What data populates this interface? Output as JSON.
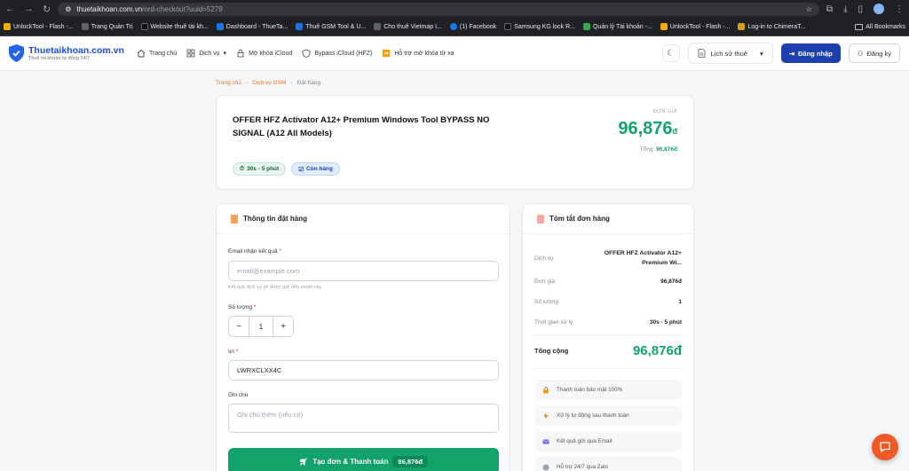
{
  "browser": {
    "url_host": "thuetaikhoan.com.vn",
    "url_path": "/ord-checkout?uuid=5279",
    "bookmarks": [
      {
        "label": "UnlockTool - Flash -..."
      },
      {
        "label": "Trang Quản Trị"
      },
      {
        "label": "Website thuê tài kh..."
      },
      {
        "label": "Dashboard - ThueTa..."
      },
      {
        "label": "Thuê GSM Tool & U..."
      },
      {
        "label": "Cho thuê Vietmap I..."
      },
      {
        "label": "(1) Facebook"
      },
      {
        "label": "Samsung KG lock R..."
      },
      {
        "label": "Quản lý Tài khoản -..."
      },
      {
        "label": "UnlockTool - Flash -..."
      },
      {
        "label": "Log-in to ChimeraT..."
      }
    ],
    "all_bookmarks": "All Bookmarks"
  },
  "header": {
    "logo_title": "Thuetaikhoan.com.vn",
    "logo_sub": "Thuê tài khoản tự động 24/7",
    "nav": [
      {
        "label": "Trang chủ"
      },
      {
        "label": "Dịch vụ"
      },
      {
        "label": "Mở khóa iCloud"
      },
      {
        "label": "Bypass iCloud (HFZ)"
      },
      {
        "label": "Hỗ trợ mở khóa từ xa"
      }
    ],
    "history_label": "Lịch sử thuê",
    "login_label": "Đăng nhập",
    "register_label": "Đăng ký"
  },
  "breadcrumb": {
    "home": "Trang chủ",
    "service": "Dịch vụ GSM",
    "current": "Đặt hàng",
    "sep": "›"
  },
  "product": {
    "title": "OFFER HFZ Activator A12+ Premium Windows Tool BYPASS NO SIGNAL (A12 All Models)",
    "time_badge": "30s - 5 phút",
    "stock_badge": "Còn hàng",
    "price_label": "ĐƠN GIÁ",
    "price": "96,876",
    "currency": "đ",
    "total_label": "Tổng:",
    "total_value": "96,876đ"
  },
  "order_form": {
    "title": "Thông tin đặt hàng",
    "email_label": "Email nhận kết quả",
    "email_placeholder": "email@example.com",
    "email_hint": "Kết quả dịch vụ sẽ được gửi đến email này",
    "qty_label": "Số lượng",
    "qty_value": "1",
    "qty_minus": "−",
    "qty_plus": "+",
    "sn_label": "sn",
    "sn_value": "LWRXCLXX4C",
    "note_label": "Ghi chú",
    "note_placeholder": "Ghi chú thêm (nếu có)",
    "submit_label": "Tạo đơn & Thanh toán",
    "submit_price": "96,876đ",
    "required_mark": "*"
  },
  "summary": {
    "title": "Tóm tắt đơn hàng",
    "service_label": "Dịch vụ",
    "service_value": "OFFER HFZ Activator A12+ Premium Wi...",
    "unit_price_label": "Đơn giá",
    "unit_price_value": "96,876đ",
    "qty_label": "Số lượng",
    "qty_value": "1",
    "time_label": "Thời gian xử lý",
    "time_value": "30s - 5 phút",
    "total_label": "Tổng cộng",
    "total_value": "96,876đ",
    "features": [
      {
        "label": "Thanh toán bảo mật 100%",
        "icon": "lock-icon"
      },
      {
        "label": "Xử lý tự động sau thanh toán",
        "icon": "bolt-icon"
      },
      {
        "label": "Kết quả gửi qua Email",
        "icon": "mail-icon"
      },
      {
        "label": "Hỗ trợ 24/7 qua Zalo",
        "icon": "chat-icon"
      }
    ]
  },
  "colors": {
    "primary": "#1e40af",
    "success": "#10a36a",
    "accent": "#f97316",
    "fab": "#f15a24"
  }
}
